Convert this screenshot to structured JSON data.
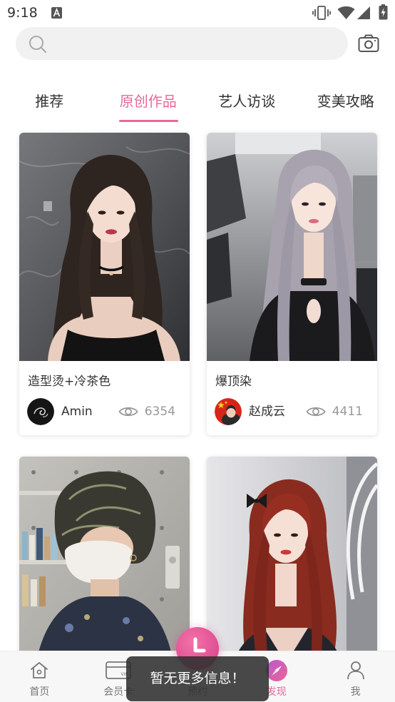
{
  "status_bar": {
    "time": "9:18",
    "icons": [
      "app-notification-icon",
      "vibrate-icon",
      "wifi-icon",
      "signal-icon",
      "battery-charging-icon"
    ]
  },
  "search": {
    "icon": "search-icon",
    "camera_icon": "camera-icon"
  },
  "tabs": [
    {
      "label": "推荐",
      "active": false
    },
    {
      "label": "原创作品",
      "active": true
    },
    {
      "label": "艺人访谈",
      "active": false
    },
    {
      "label": "变美攻略",
      "active": false
    }
  ],
  "feed": {
    "cards": [
      {
        "title": "造型烫+冷茶色",
        "author": "Amin",
        "views": 6354
      },
      {
        "title": "爆顶染",
        "author": "赵成云",
        "views": 4411
      }
    ],
    "view_icon": "eye-icon"
  },
  "bottom_nav": {
    "items": [
      {
        "label": "首页",
        "icon": "home-icon",
        "active": false
      },
      {
        "label": "会员卡",
        "icon": "vip-card-icon",
        "active": false
      },
      {
        "label": "预约",
        "icon": "clock-icon",
        "active": false
      },
      {
        "label": "发现",
        "icon": "compass-icon",
        "active": true
      },
      {
        "label": "我",
        "icon": "person-icon",
        "active": false
      }
    ],
    "vip_badge": "VIP"
  },
  "toast": {
    "message": "暂无更多信息！"
  },
  "colors": {
    "accent": "#e9679a",
    "text": "#333333",
    "muted": "#999999",
    "nav_bg": "#f7f7f7",
    "toast_bg": "#303030"
  }
}
